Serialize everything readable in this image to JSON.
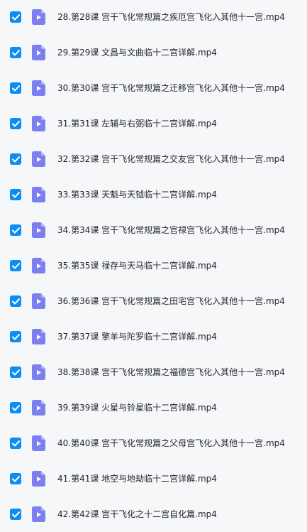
{
  "colors": {
    "background": "#f6f7f9",
    "checkbox": "#0d8cf2",
    "file_icon": "#7b7ff0",
    "file_icon_fold": "#b4b6fa",
    "text": "#1f2329"
  },
  "file_list": {
    "items": [
      {
        "checked": true,
        "icon": "video-file-icon",
        "name": "28.第28课 宫干飞化常规篇之疾厄宫飞化入其他十一宫.mp4"
      },
      {
        "checked": true,
        "icon": "video-file-icon",
        "name": "29.第29课 文昌与文曲临十二宫详解.mp4"
      },
      {
        "checked": true,
        "icon": "video-file-icon",
        "name": "30.第30课 宫干飞化常规篇之迁移宫飞化入其他十一宫.mp4"
      },
      {
        "checked": true,
        "icon": "video-file-icon",
        "name": "31.第31课 左辅与右弼临十二宫详解.mp4"
      },
      {
        "checked": true,
        "icon": "video-file-icon",
        "name": "32.第32课 宫干飞化常规篇之交友宫飞化入其他十一宫.mp4"
      },
      {
        "checked": true,
        "icon": "video-file-icon",
        "name": "33.第33课 天魁与天钺临十二宫详解.mp4"
      },
      {
        "checked": true,
        "icon": "video-file-icon",
        "name": "34.第34课 宫干飞化常规篇之官禄宫飞化入其他十一宫.mp4"
      },
      {
        "checked": true,
        "icon": "video-file-icon",
        "name": "35.第35课 禄存与天马临十二宫详解.mp4"
      },
      {
        "checked": true,
        "icon": "video-file-icon",
        "name": "36.第36课 宫干飞化常规篇之田宅宫飞化入其他十一宫.mp4"
      },
      {
        "checked": true,
        "icon": "video-file-icon",
        "name": "37.第37课 擎羊与陀罗临十二宫详解.mp4"
      },
      {
        "checked": true,
        "icon": "video-file-icon",
        "name": "38.第38课 宫干飞化常规篇之福德宫飞化入其他十一宫.mp4"
      },
      {
        "checked": true,
        "icon": "video-file-icon",
        "name": "39.第39课 火星与铃星临十二宫详解.mp4"
      },
      {
        "checked": true,
        "icon": "video-file-icon",
        "name": "40.第40课 宫干飞化常规篇之父母宫飞化入其他十一宫.mp4"
      },
      {
        "checked": true,
        "icon": "video-file-icon",
        "name": "41.第41课 地空与地劫临十二宫详解.mp4"
      },
      {
        "checked": true,
        "icon": "video-file-icon",
        "name": "42.第42课 宫干飞化之十二宫自化篇.mp4"
      }
    ]
  }
}
